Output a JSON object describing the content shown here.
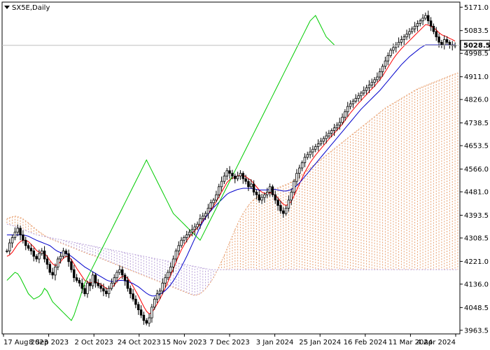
{
  "chart_data": {
    "type": "candlestick",
    "title": "SX5E,Daily",
    "current_price": "5028.5",
    "y_ticks": [
      "5171.0",
      "5083.5",
      "4998.5",
      "4911.0",
      "4826.0",
      "4738.5",
      "4653.5",
      "4566.0",
      "4481.0",
      "4393.5",
      "4308.5",
      "4221.0",
      "4136.0",
      "4048.5",
      "3963.5"
    ],
    "x_ticks": [
      "17 Aug 2023",
      "8 Sep 2023",
      "2 Oct 2023",
      "24 Oct 2023",
      "15 Nov 2023",
      "7 Dec 2023",
      "3 Jan 2024",
      "25 Jan 2024",
      "16 Feb 2024",
      "11 Mar 2024",
      "4 Apr 2024"
    ],
    "ylim": [
      3950,
      5190
    ],
    "n_bars": 168,
    "series": [
      {
        "name": "",
        "kind": "candles",
        "closes": [
          4260,
          4290,
          4310,
          4330,
          4345,
          4320,
          4300,
          4280,
          4270,
          4260,
          4240,
          4230,
          4250,
          4260,
          4230,
          4210,
          4180,
          4170,
          4200,
          4230,
          4240,
          4260,
          4250,
          4220,
          4190,
          4160,
          4150,
          4140,
          4120,
          4100,
          4140,
          4130,
          4170,
          4140,
          4130,
          4120,
          4110,
          4100,
          4120,
          4140,
          4160,
          4180,
          4190,
          4170,
          4150,
          4120,
          4100,
          4080,
          4060,
          4040,
          4020,
          4000,
          3990,
          4010,
          4050,
          4080,
          4100,
          4110,
          4140,
          4160,
          4180,
          4200,
          4230,
          4260,
          4280,
          4300,
          4310,
          4320,
          4330,
          4340,
          4350,
          4360,
          4380,
          4390,
          4400,
          4420,
          4440,
          4450,
          4470,
          4500,
          4520,
          4540,
          4560,
          4550,
          4540,
          4530,
          4540,
          4550,
          4530,
          4520,
          4500,
          4510,
          4480,
          4470,
          4450,
          4460,
          4470,
          4480,
          4500,
          4470,
          4450,
          4430,
          4410,
          4400,
          4420,
          4450,
          4480,
          4520,
          4550,
          4570,
          4590,
          4610,
          4620,
          4630,
          4640,
          4650,
          4660,
          4670,
          4680,
          4690,
          4700,
          4710,
          4720,
          4730,
          4740,
          4760,
          4780,
          4800,
          4810,
          4820,
          4830,
          4840,
          4850,
          4860,
          4870,
          4880,
          4890,
          4900,
          4910,
          4930,
          4950,
          4970,
          4990,
          5010,
          5020,
          5030,
          5040,
          5050,
          5060,
          5070,
          5080,
          5090,
          5100,
          5110,
          5120,
          5130,
          5140,
          5120,
          5100,
          5080,
          5060,
          5040,
          5030,
          5050,
          5040,
          5030,
          5028.5,
          5028.5
        ]
      },
      {
        "name": "",
        "kind": "line",
        "color": "#ff0000",
        "values": [
          4240,
          4245,
          4255,
          4270,
          4285,
          4295,
          4300,
          4300,
          4295,
          4285,
          4275,
          4262,
          4255,
          4255,
          4250,
          4240,
          4225,
          4212,
          4205,
          4210,
          4220,
          4232,
          4240,
          4238,
          4228,
          4212,
          4195,
          4180,
          4165,
          4150,
          4145,
          4140,
          4145,
          4145,
          4140,
          4135,
          4128,
          4120,
          4118,
          4122,
          4132,
          4145,
          4158,
          4165,
          4165,
          4158,
          4145,
          4128,
          4110,
          4092,
          4072,
          4052,
          4035,
          4025,
          4030,
          4045,
          4062,
          4080,
          4100,
          4122,
          4145,
          4168,
          4192,
          4218,
          4242,
          4264,
          4282,
          4298,
          4312,
          4324,
          4336,
          4347,
          4360,
          4372,
          4385,
          4398,
          4414,
          4428,
          4444,
          4462,
          4480,
          4498,
          4516,
          4526,
          4532,
          4536,
          4540,
          4544,
          4542,
          4538,
          4530,
          4524,
          4512,
          4500,
          4488,
          4480,
          4475,
          4474,
          4478,
          4474,
          4468,
          4458,
          4446,
          4434,
          4430,
          4434,
          4446,
          4466,
          4488,
          4510,
          4532,
          4554,
          4572,
          4590,
          4604,
          4618,
          4630,
          4642,
          4654,
          4666,
          4678,
          4690,
          4700,
          4712,
          4722,
          4734,
          4748,
          4762,
          4776,
          4788,
          4800,
          4812,
          4822,
          4834,
          4844,
          4856,
          4866,
          4876,
          4888,
          4900,
          4914,
          4930,
          4946,
          4962,
          4978,
          4992,
          5004,
          5016,
          5026,
          5036,
          5046,
          5056,
          5066,
          5076,
          5086,
          5096,
          5106,
          5104,
          5100,
          5094,
          5086,
          5076,
          5068,
          5064,
          5060,
          5054,
          5050,
          5044
        ]
      },
      {
        "name": "",
        "kind": "line",
        "color": "#0000cc",
        "values": [
          4320,
          4320,
          4320,
          4320,
          4320,
          4320,
          4320,
          4318,
          4315,
          4310,
          4305,
          4300,
          4296,
          4292,
          4288,
          4284,
          4280,
          4272,
          4264,
          4258,
          4254,
          4252,
          4250,
          4246,
          4240,
          4232,
          4224,
          4216,
          4208,
          4200,
          4194,
          4188,
          4182,
          4176,
          4170,
          4164,
          4158,
          4152,
          4148,
          4146,
          4146,
          4148,
          4150,
          4150,
          4148,
          4146,
          4142,
          4138,
          4132,
          4126,
          4118,
          4110,
          4102,
          4096,
          4092,
          4092,
          4094,
          4098,
          4104,
          4112,
          4122,
          4134,
          4148,
          4164,
          4182,
          4200,
          4220,
          4240,
          4262,
          4284,
          4306,
          4328,
          4350,
          4368,
          4384,
          4398,
          4410,
          4422,
          4432,
          4442,
          4452,
          4462,
          4472,
          4478,
          4482,
          4486,
          4490,
          4492,
          4494,
          4494,
          4494,
          4494,
          4492,
          4490,
          4488,
          4488,
          4488,
          4488,
          4490,
          4490,
          4490,
          4488,
          4486,
          4484,
          4484,
          4486,
          4490,
          4496,
          4504,
          4514,
          4526,
          4538,
          4550,
          4562,
          4574,
          4586,
          4598,
          4610,
          4622,
          4634,
          4646,
          4658,
          4670,
          4682,
          4694,
          4706,
          4718,
          4730,
          4742,
          4754,
          4766,
          4778,
          4790,
          4800,
          4810,
          4820,
          4830,
          4840,
          4850,
          4860,
          4872,
          4884,
          4896,
          4908,
          4920,
          4932,
          4944,
          4956,
          4966,
          4976,
          4986,
          4994,
          5002,
          5010,
          5018,
          5024,
          5030,
          5030,
          5030,
          5030,
          5030,
          5030,
          5030,
          5030,
          5030,
          5030,
          5030,
          5030
        ]
      },
      {
        "name": "",
        "kind": "line",
        "color": "#00cc00",
        "values": [
          4150,
          4160,
          4170,
          4180,
          4175,
          4160,
          4140,
          4120,
          4100,
          4090,
          4080,
          4085,
          4090,
          4100,
          4120,
          4110,
          4090,
          4070,
          4060,
          4050,
          4040,
          4030,
          4020,
          4010,
          4000,
          4020,
          4050,
          4080,
          4110,
          4140,
          4160,
          4180,
          4200,
          4220,
          4240,
          4260,
          4280,
          4300,
          4320,
          4340,
          4360,
          4380,
          4400,
          4420,
          4440,
          4460,
          4480,
          4500,
          4520,
          4540,
          4560,
          4580,
          4600,
          4580,
          4560,
          4540,
          4520,
          4500,
          4480,
          4460,
          4440,
          4420,
          4400,
          4390,
          4380,
          4370,
          4360,
          4350,
          4340,
          4330,
          4320,
          4310,
          4300,
          4320,
          4340,
          4360,
          4380,
          4400,
          4420,
          4440,
          4460,
          4480,
          4500,
          4520,
          4540,
          4560,
          4580,
          4600,
          4620,
          4640,
          4660,
          4680,
          4700,
          4720,
          4740,
          4760,
          4780,
          4800,
          4820,
          4840,
          4860,
          4880,
          4900,
          4920,
          4940,
          4960,
          4980,
          5000,
          5020,
          5040,
          5060,
          5080,
          5100,
          5120,
          5130,
          5140,
          5120,
          5100,
          5080,
          5060,
          5050,
          5040,
          5030
        ]
      },
      {
        "name": "",
        "kind": "cloud",
        "span_a": [
          4380,
          4385,
          4388,
          4390,
          4388,
          4385,
          4380,
          4372,
          4365,
          4356,
          4348,
          4340,
          4332,
          4325,
          4318,
          4312,
          4306,
          4302,
          4298,
          4294,
          4290,
          4286,
          4282,
          4278,
          4274,
          4270,
          4266,
          4262,
          4258,
          4254,
          4250,
          4246,
          4244,
          4240,
          4236,
          4232,
          4228,
          4224,
          4220,
          4216,
          4212,
          4208,
          4204,
          4200,
          4196,
          4192,
          4188,
          4184,
          4180,
          4176,
          4172,
          4168,
          4164,
          4160,
          4156,
          4152,
          4148,
          4144,
          4140,
          4136,
          4132,
          4128,
          4124,
          4120,
          4116,
          4112,
          4108,
          4104,
          4100,
          4096,
          4094,
          4096,
          4100,
          4108,
          4118,
          4130,
          4145,
          4160,
          4180,
          4200,
          4222,
          4244,
          4268,
          4292,
          4316,
          4340,
          4362,
          4382,
          4400,
          4416,
          4430,
          4442,
          4452,
          4460,
          4466,
          4472,
          4476,
          4480,
          4484,
          4488,
          4492,
          4496,
          4500,
          4504,
          4508,
          4512,
          4518,
          4524,
          4530,
          4538,
          4546,
          4554,
          4562,
          4570,
          4578,
          4586,
          4594,
          4602,
          4610,
          4618,
          4626,
          4634,
          4642,
          4650,
          4658,
          4666,
          4674,
          4682,
          4690,
          4698,
          4706,
          4714,
          4722,
          4730,
          4738,
          4746,
          4754,
          4762,
          4770,
          4778,
          4786,
          4794,
          4800,
          4806,
          4812,
          4818,
          4824,
          4830,
          4836,
          4842,
          4848,
          4854,
          4860,
          4866,
          4870,
          4874,
          4878,
          4882,
          4886,
          4890,
          4894,
          4898,
          4902,
          4906,
          4910,
          4914,
          4918,
          4922,
          4926,
          4930,
          4934,
          4938,
          4942,
          4946,
          4950,
          4954,
          4958,
          4962
        ],
        "span_b": [
          4360,
          4358,
          4355,
          4352,
          4348,
          4344,
          4340,
          4336,
          4332,
          4328,
          4324,
          4320,
          4318,
          4316,
          4314,
          4312,
          4310,
          4308,
          4306,
          4304,
          4302,
          4300,
          4298,
          4296,
          4294,
          4292,
          4290,
          4288,
          4286,
          4284,
          4282,
          4280,
          4278,
          4276,
          4274,
          4272,
          4270,
          4268,
          4266,
          4264,
          4262,
          4260,
          4258,
          4256,
          4254,
          4252,
          4250,
          4248,
          4246,
          4244,
          4242,
          4240,
          4238,
          4236,
          4234,
          4232,
          4230,
          4228,
          4226,
          4224,
          4222,
          4220,
          4218,
          4216,
          4214,
          4212,
          4210,
          4208,
          4206,
          4204,
          4202,
          4200,
          4198,
          4196,
          4194,
          4192,
          4190,
          4190,
          4190,
          4190,
          4190,
          4190,
          4190,
          4190,
          4190,
          4190,
          4190,
          4190,
          4190,
          4190,
          4190,
          4190,
          4190,
          4190,
          4190,
          4190,
          4190,
          4190,
          4190,
          4190,
          4190,
          4190,
          4190,
          4190,
          4190,
          4190,
          4190,
          4190,
          4190,
          4190,
          4190,
          4190,
          4190,
          4190,
          4190,
          4190,
          4190,
          4190,
          4190,
          4190,
          4190,
          4190,
          4190,
          4190,
          4190,
          4190,
          4190,
          4190,
          4190,
          4190,
          4190,
          4190,
          4190,
          4190,
          4190,
          4190,
          4190,
          4190,
          4190,
          4190,
          4190,
          4190,
          4190,
          4190,
          4190,
          4190,
          4190,
          4190,
          4190,
          4190,
          4190,
          4190,
          4190,
          4190,
          4190,
          4190,
          4190,
          4190,
          4190,
          4190,
          4190,
          4190,
          4190,
          4190,
          4190,
          4190,
          4190,
          4190,
          4190,
          4190,
          4190,
          4190,
          4190,
          4190,
          4190,
          4190,
          4190,
          4190,
          4190,
          4190
        ]
      }
    ]
  }
}
